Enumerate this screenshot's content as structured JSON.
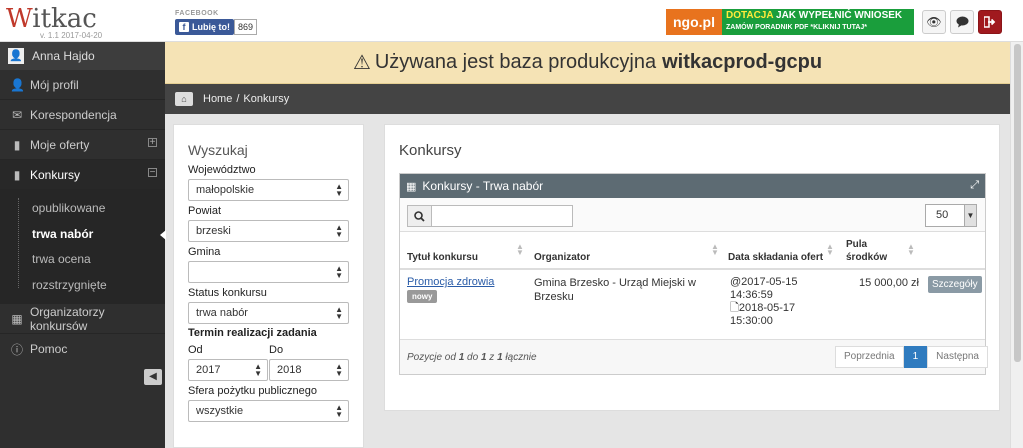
{
  "app": {
    "logo": "Witkac",
    "version": "v. 1.1 2017-04-20"
  },
  "facebook": {
    "label": "FACEBOOK",
    "like_text": "Lubię to!",
    "count": "869"
  },
  "ad_banner": {
    "brand": "ngo.pl",
    "highlight": "DOTACJA",
    "headline": "JAK WYPEŁNIĆ WNIOSEK",
    "subline": "ZAMÓW PORADNIK PDF  *KLIKNIJ TUTAJ*"
  },
  "top_buttons": [
    {
      "icon": "eye-icon"
    },
    {
      "icon": "comment-icon"
    },
    {
      "icon": "logout-icon"
    }
  ],
  "user": {
    "name": "Anna Hajdo"
  },
  "sidebar": {
    "items": [
      {
        "label": "Mój profil",
        "icon": "user-icon"
      },
      {
        "label": "Korespondencja",
        "icon": "envelope-icon"
      },
      {
        "label": "Moje oferty",
        "icon": "book-icon"
      },
      {
        "label": "Konkursy",
        "icon": "book-icon"
      },
      {
        "label": "Organizatorzy konkursów",
        "icon": "building-icon"
      },
      {
        "label": "Pomoc",
        "icon": "info-icon"
      }
    ],
    "subitems": [
      {
        "label": "opublikowane"
      },
      {
        "label": "trwa nabór"
      },
      {
        "label": "trwa ocena"
      },
      {
        "label": "rozstrzygnięte"
      }
    ]
  },
  "warning": {
    "text": "Używana jest baza produkcyjna",
    "db": "witkacprod-gcpu"
  },
  "breadcrumb": {
    "home": "Home",
    "sep": "/",
    "current": "Konkursy"
  },
  "search": {
    "title": "Wyszukaj",
    "wojewodztwo_label": "Województwo",
    "wojewodztwo_value": "małopolskie",
    "powiat_label": "Powiat",
    "powiat_value": "brzeski",
    "gmina_label": "Gmina",
    "gmina_value": "",
    "status_label": "Status konkursu",
    "status_value": "trwa nabór",
    "termin_label": "Termin realizacji zadania",
    "od_label": "Od",
    "od_value": "2017",
    "do_label": "Do",
    "do_value": "2018",
    "sfera_label": "Sfera pożytku publicznego",
    "sfera_value": "wszystkie"
  },
  "main": {
    "title": "Konkursy",
    "widget_title": "Konkursy - Trwa nabór",
    "page_size": "50",
    "columns": {
      "title": "Tytuł konkursu",
      "org": "Organizator",
      "date": "Data składania ofert",
      "pool_1": "Pula",
      "pool_2": "środków"
    },
    "rows": [
      {
        "title": "Promocja zdrowia",
        "badge": "nowy",
        "org_1": "Gmina Brzesko - Urząd Miejski w",
        "org_2": "Brzesku",
        "start_1": "2017-05-15",
        "start_2": "14:36:59",
        "end_1": "2018-05-17",
        "end_2": "15:30:00",
        "pool": "15 000,00 zł",
        "details": "Szczegóły"
      }
    ],
    "info_pre": "Pozycje od",
    "info_from": "1",
    "info_mid1": "do",
    "info_to": "1",
    "info_mid2": "z",
    "info_total": "1",
    "info_post": "łącznie",
    "prev": "Poprzednia",
    "page": "1",
    "next": "Następna"
  }
}
